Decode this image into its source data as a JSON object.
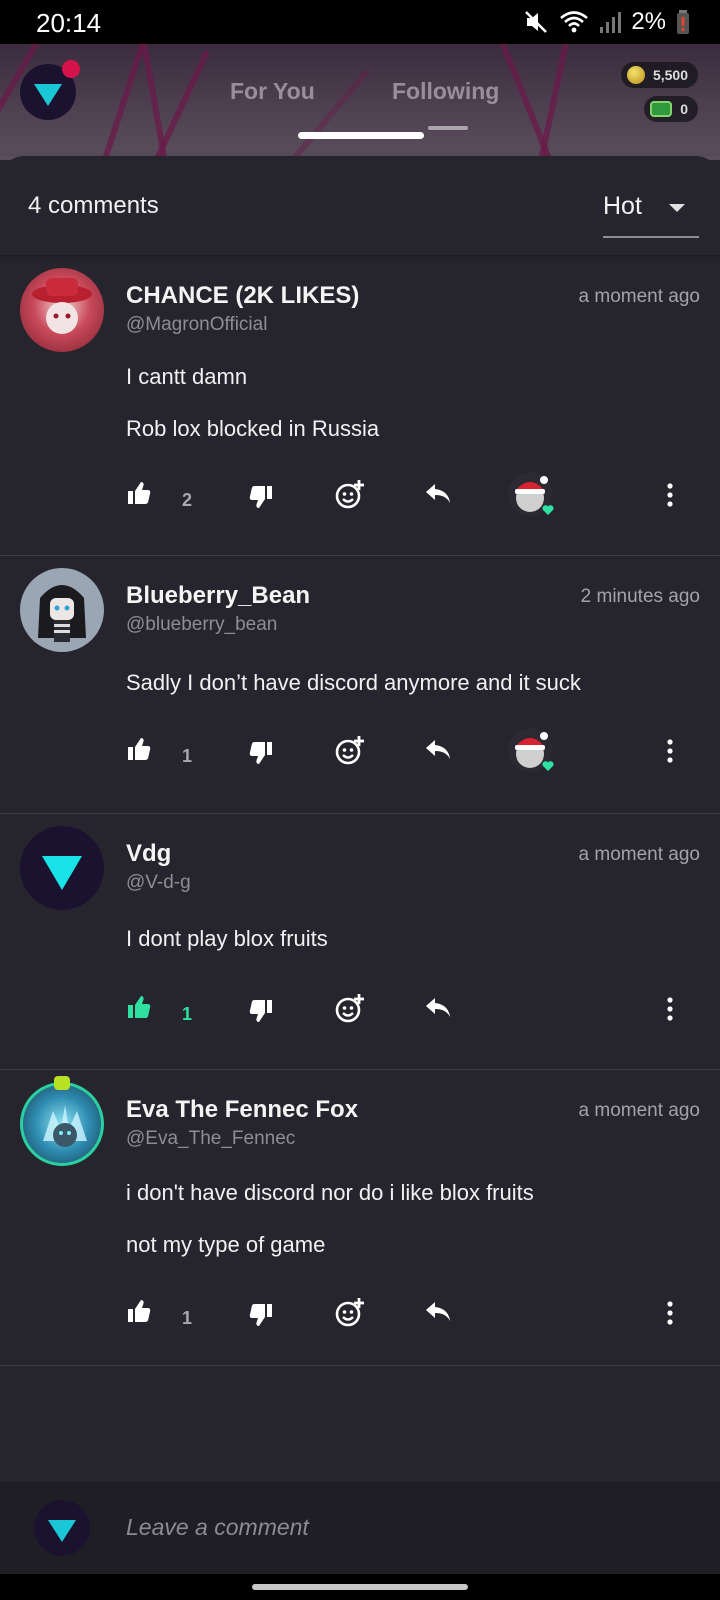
{
  "status_bar": {
    "time": "20:14",
    "battery": "2%"
  },
  "header": {
    "tabs": [
      {
        "label": "For You"
      },
      {
        "label": "Following"
      }
    ],
    "coins": "5,500",
    "cash": "0"
  },
  "comments_sheet": {
    "count_label": "4 comments",
    "sort_label": "Hot"
  },
  "comments": [
    {
      "name": "CHANCE (2K LIKES)",
      "handle": "@MagronOfficial",
      "time": "a moment ago",
      "lines": [
        "I cantt damn",
        "Rob lox blocked in Russia"
      ],
      "likes": "2"
    },
    {
      "name": "Blueberry_Bean",
      "handle": "@blueberry_bean",
      "time": "2 minutes ago",
      "lines": [
        "Sadly I don’t have discord anymore and it suck"
      ],
      "likes": "1"
    },
    {
      "name": "Vdg",
      "handle": "@V-d-g",
      "time": "a moment ago",
      "lines": [
        "I dont play blox fruits"
      ],
      "likes": "1"
    },
    {
      "name": "Eva The Fennec Fox",
      "handle": "@Eva_The_Fennec",
      "time": "a moment ago",
      "lines": [
        "i don't have discord nor do i like blox fruits",
        "not my type of game"
      ],
      "likes": "1"
    }
  ],
  "composer": {
    "placeholder": "Leave a comment"
  },
  "colors": {
    "accent": "#19c7d6",
    "liked": "#2fe0a1",
    "background": "#26252e"
  }
}
